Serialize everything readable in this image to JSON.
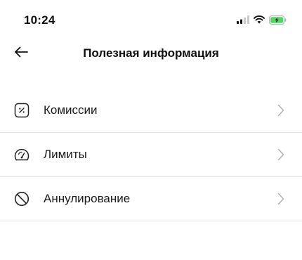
{
  "status_bar": {
    "time": "10:24",
    "icons": [
      "signal-icon",
      "wifi-icon",
      "battery-charging-icon"
    ],
    "battery_color": "#4cd964"
  },
  "header": {
    "title": "Полезная информация",
    "back_icon": "arrow-left-icon"
  },
  "menu": {
    "items": [
      {
        "label": "Комиссии",
        "icon": "percent-icon"
      },
      {
        "label": "Лимиты",
        "icon": "speedometer-icon"
      },
      {
        "label": "Аннулирование",
        "icon": "cancel-circle-icon"
      }
    ],
    "chevron_icon": "chevron-right-icon"
  },
  "colors": {
    "text": "#111111",
    "divider": "#e4e4e4",
    "chevron": "#b0b0b0",
    "background": "#ffffff"
  }
}
